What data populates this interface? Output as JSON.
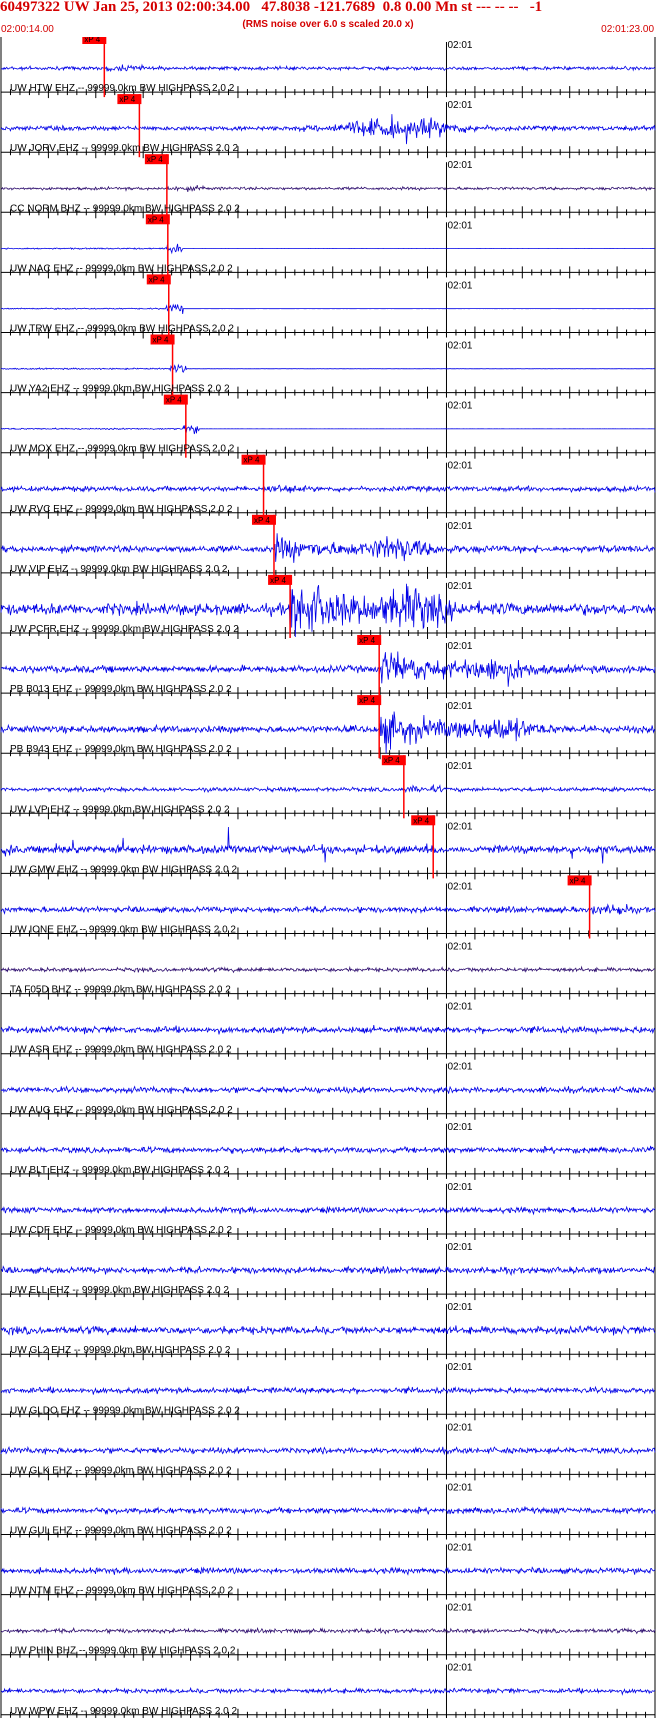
{
  "header": {
    "title": "60497322 UW Jan 25, 2013 02:00:34.00   47.8038 -121.7689  0.8 0.00 Mn st --- -- --   -1",
    "subtitle": "(RMS noise over 6.0 s scaled 20.0 x)",
    "start_time": "02:00:14.00",
    "end_time": "02:01:23.00"
  },
  "colors": {
    "header": "#d40000",
    "trace": "#0000e6",
    "trace_dark": "#301070",
    "pick": "#ff0000",
    "axis": "#000000",
    "label": "#000000"
  },
  "chart_data": {
    "type": "line",
    "title": "60497322 UW Jan 25, 2013 02:00:34.00   47.8038 -121.7689  0.8 0.00 Mn st --- -- --   -1",
    "xlabel": "",
    "ylabel": "",
    "xlim": [
      "02:00:14.00",
      "02:01:23.00"
    ],
    "mid_tick_label": "02:01",
    "pick_label": "xP 4",
    "traces": [
      {
        "name": "UW HTW EHZ -- 99999.0km BW  HIGHPASS  2.0  2",
        "pick_s": 10.9,
        "style": "noise",
        "amp": 0.06,
        "color": "blue"
      },
      {
        "name": "UW JORV EHZ -- 99999.0km BW  HIGHPASS  2.0  2",
        "pick_s": 14.6,
        "style": "burst",
        "amp": 0.08,
        "color": "blue"
      },
      {
        "name": "CC NORM BHZ -- 99999.0km BW  HIGHPASS  2.0  2",
        "pick_s": 17.5,
        "style": "noise",
        "amp": 0.05,
        "color": "dark"
      },
      {
        "name": "UW NAC EHZ -- 99999.0km BW  HIGHPASS  2.0  2",
        "pick_s": 17.6,
        "style": "flat",
        "amp": 0.02,
        "color": "blue"
      },
      {
        "name": "UW TRW EHZ -- 99999.0km BW  HIGHPASS  2.0  2",
        "pick_s": 17.7,
        "style": "flat",
        "amp": 0.02,
        "color": "blue"
      },
      {
        "name": "UW YA2 EHZ -- 99999.0km BW  HIGHPASS  2.0  2",
        "pick_s": 18.1,
        "style": "flat",
        "amp": 0.02,
        "color": "blue"
      },
      {
        "name": "UW MOX EHZ -- 99999.0km BW  HIGHPASS  2.0  2",
        "pick_s": 19.5,
        "style": "flat",
        "amp": 0.02,
        "color": "blue"
      },
      {
        "name": "UW RVC EHZ -- 99999.0km BW  HIGHPASS  2.0  2",
        "pick_s": 27.7,
        "style": "noise",
        "amp": 0.09,
        "color": "blue"
      },
      {
        "name": "UW VIP EHZ -- 99999.0km BW  HIGHPASS  2.0  2",
        "pick_s": 28.8,
        "style": "quake",
        "amp": 0.12,
        "color": "blue"
      },
      {
        "name": "UW PCFR EHZ -- 99999.0km BW  HIGHPASS  2.0  2",
        "pick_s": 30.5,
        "style": "quake_big",
        "amp": 0.2,
        "color": "blue"
      },
      {
        "name": "PB B013 EHZ -- 99999.0km BW  HIGHPASS  2.0  2",
        "pick_s": 39.9,
        "style": "quake_big",
        "amp": 0.12,
        "color": "blue"
      },
      {
        "name": "PB B943 EHZ -- 99999.0km BW  HIGHPASS  2.0  2",
        "pick_s": 39.9,
        "style": "quake_big",
        "amp": 0.12,
        "color": "blue"
      },
      {
        "name": "UW LVP EHZ -- 99999.0km BW  HIGHPASS  2.0  2",
        "pick_s": 42.5,
        "style": "noise",
        "amp": 0.07,
        "color": "blue"
      },
      {
        "name": "UW GMW EHZ -- 99999.0km BW  HIGHPASS  2.0  2",
        "pick_s": 45.6,
        "style": "spiky",
        "amp": 0.14,
        "color": "blue"
      },
      {
        "name": "UW IONE EHZ -- 99999.0km BW  HIGHPASS  2.0  2",
        "pick_s": 62.1,
        "style": "noise",
        "amp": 0.1,
        "color": "blue"
      },
      {
        "name": "TA F05D BHZ -- 99999.0km BW  HIGHPASS  2.0  2",
        "pick_s": null,
        "style": "noise",
        "amp": 0.07,
        "color": "dark"
      },
      {
        "name": "UW ASR EHZ -- 99999.0km BW  HIGHPASS  2.0  2",
        "pick_s": null,
        "style": "noise",
        "amp": 0.11,
        "color": "blue"
      },
      {
        "name": "UW AUG EHZ -- 99999.0km BW  HIGHPASS  2.0  2",
        "pick_s": null,
        "style": "noise",
        "amp": 0.1,
        "color": "blue"
      },
      {
        "name": "UW BLT EHZ -- 99999.0km BW  HIGHPASS  2.0  2",
        "pick_s": null,
        "style": "noise",
        "amp": 0.1,
        "color": "blue"
      },
      {
        "name": "UW CDF EHZ -- 99999.0km BW  HIGHPASS  2.0  2",
        "pick_s": null,
        "style": "noise",
        "amp": 0.1,
        "color": "blue"
      },
      {
        "name": "UW ELL EHZ -- 99999.0km BW  HIGHPASS  2.0  2",
        "pick_s": null,
        "style": "noise",
        "amp": 0.11,
        "color": "blue"
      },
      {
        "name": "UW GL2 EHZ -- 99999.0km BW  HIGHPASS  2.0  2",
        "pick_s": null,
        "style": "noise",
        "amp": 0.13,
        "color": "blue"
      },
      {
        "name": "UW GLDO EHZ -- 99999.0km BW  HIGHPASS  2.0  2",
        "pick_s": null,
        "style": "noise",
        "amp": 0.1,
        "color": "blue"
      },
      {
        "name": "UW GLK EHZ -- 99999.0km BW  HIGHPASS  2.0  2",
        "pick_s": null,
        "style": "noise",
        "amp": 0.1,
        "color": "blue"
      },
      {
        "name": "UW GUL EHZ -- 99999.0km BW  HIGHPASS  2.0  2",
        "pick_s": null,
        "style": "noise",
        "amp": 0.1,
        "color": "blue"
      },
      {
        "name": "UW NTM EHZ -- 99999.0km BW  HIGHPASS  2.0  2",
        "pick_s": null,
        "style": "noise",
        "amp": 0.1,
        "color": "blue"
      },
      {
        "name": "UW PHIN BHZ -- 99999.0km BW  HIGHPASS  2.0  2",
        "pick_s": null,
        "style": "noise",
        "amp": 0.07,
        "color": "dark"
      },
      {
        "name": "UW WPW EHZ -- 99999.0km BW  HIGHPASS  2.0  2",
        "pick_s": null,
        "style": "noise",
        "amp": 0.08,
        "color": "blue"
      }
    ]
  }
}
